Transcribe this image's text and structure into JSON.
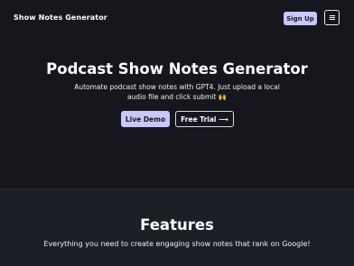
{
  "header": {
    "brand": "Show Notes Generator",
    "signup_label": "Sign Up",
    "menu_icon": "hamburger-menu-icon"
  },
  "hero": {
    "title": "Podcast Show Notes Generator",
    "subtitle": "Automate podcast show notes with GPT4. Just upload a local audio file and click submit 🙌",
    "demo_label": "Live Demo",
    "trial_label": "Free Trial ⟶"
  },
  "features": {
    "title": "Features",
    "subtitle": "Everything you need to create engaging show notes that rank on Google!"
  },
  "colors": {
    "background": "#16171d",
    "accent": "#c9c7ff",
    "section_background": "#1d1f26"
  }
}
